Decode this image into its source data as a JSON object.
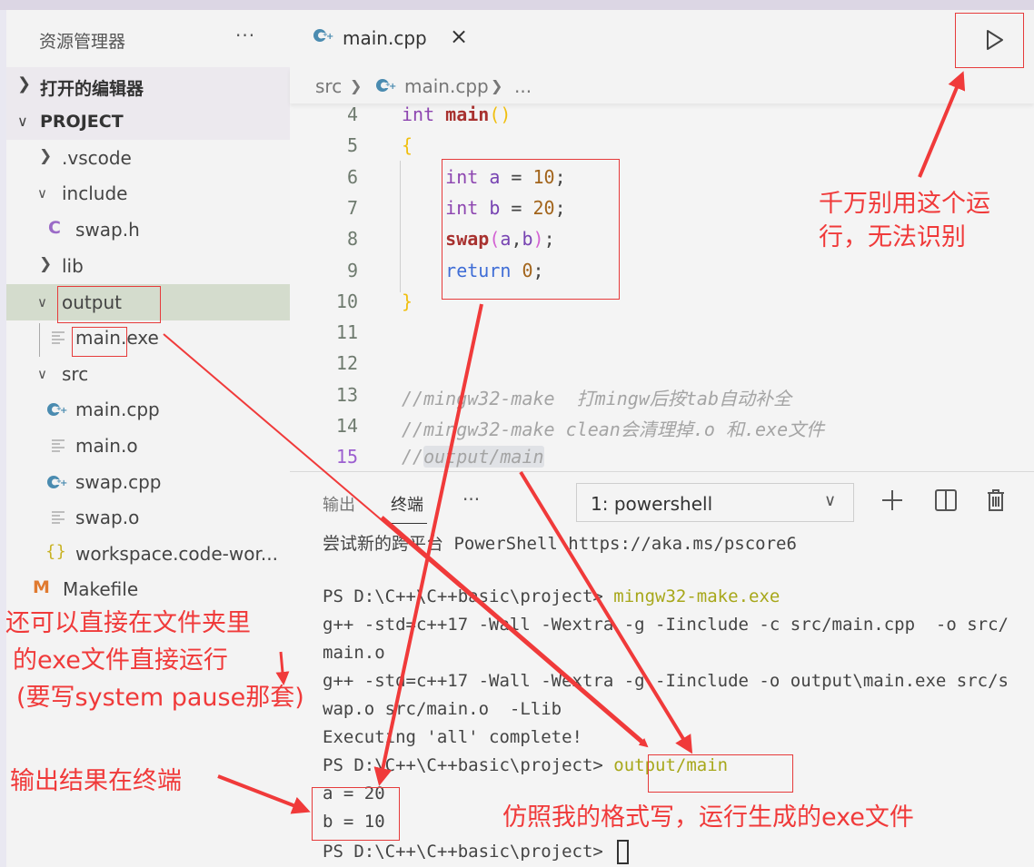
{
  "sidebar": {
    "title": "资源管理器",
    "more_label": "···",
    "open_editors_label": "打开的编辑器",
    "project_label": "PROJECT",
    "tree": [
      {
        "label": ".vscode",
        "type": "folder",
        "expanded": false
      },
      {
        "label": "include",
        "type": "folder",
        "expanded": true
      },
      {
        "label": "swap.h",
        "type": "c-header",
        "icon": "C"
      },
      {
        "label": "lib",
        "type": "folder",
        "expanded": false
      },
      {
        "label": "output",
        "type": "folder",
        "expanded": true,
        "selected": true
      },
      {
        "label": "main.exe",
        "type": "file"
      },
      {
        "label": "src",
        "type": "folder",
        "expanded": true
      },
      {
        "label": "main.cpp",
        "type": "cpp"
      },
      {
        "label": "main.o",
        "type": "file"
      },
      {
        "label": "swap.cpp",
        "type": "cpp"
      },
      {
        "label": "swap.o",
        "type": "file"
      },
      {
        "label": "workspace.code-wor...",
        "type": "json",
        "icon": "{}"
      },
      {
        "label": "Makefile",
        "type": "makefile",
        "icon": "M"
      }
    ]
  },
  "editor": {
    "tab_label": "main.cpp",
    "close_label": "×",
    "breadcrumb": {
      "folder": "src",
      "file": "main.cpp",
      "rest": "..."
    },
    "lines": [
      {
        "n": "4",
        "tokens": [
          [
            "kw",
            "int "
          ],
          [
            "fn",
            "main"
          ],
          [
            "br",
            "()"
          ]
        ]
      },
      {
        "n": "5",
        "tokens": [
          [
            "br",
            "{"
          ]
        ]
      },
      {
        "n": "6",
        "tokens": [
          [
            "pl",
            "    "
          ],
          [
            "kw",
            "int "
          ],
          [
            "var",
            "a"
          ],
          [
            "pl",
            " = "
          ],
          [
            "num",
            "10"
          ],
          [
            "pl",
            ";"
          ]
        ]
      },
      {
        "n": "7",
        "tokens": [
          [
            "pl",
            "    "
          ],
          [
            "kw",
            "int "
          ],
          [
            "var",
            "b"
          ],
          [
            "pl",
            " = "
          ],
          [
            "num",
            "20"
          ],
          [
            "pl",
            ";"
          ]
        ]
      },
      {
        "n": "8",
        "tokens": [
          [
            "pl",
            "    "
          ],
          [
            "fn",
            "swap"
          ],
          [
            "br2",
            "("
          ],
          [
            "var",
            "a"
          ],
          [
            "pl",
            ","
          ],
          [
            "var",
            "b"
          ],
          [
            "br2",
            ")"
          ],
          [
            "pl",
            ";"
          ]
        ]
      },
      {
        "n": "9",
        "tokens": [
          [
            "pl",
            "    "
          ],
          [
            "kw2",
            "return "
          ],
          [
            "num",
            "0"
          ],
          [
            "pl",
            ";"
          ]
        ]
      },
      {
        "n": "10",
        "tokens": [
          [
            "br",
            "}"
          ]
        ]
      },
      {
        "n": "11",
        "tokens": []
      },
      {
        "n": "12",
        "tokens": []
      },
      {
        "n": "13",
        "tokens": [
          [
            "cm",
            "//mingw32-make  打mingw后按tab自动补全"
          ]
        ]
      },
      {
        "n": "14",
        "tokens": [
          [
            "cm",
            "//mingw32-make clean会清理掉.o 和.exe文件"
          ]
        ]
      },
      {
        "n": "15",
        "tokens": [
          [
            "cm",
            "//"
          ],
          [
            "cm cm-hl",
            "output/main"
          ]
        ],
        "active": true
      }
    ]
  },
  "panel": {
    "tabs": [
      "输出",
      "终端"
    ],
    "active_tab": "终端",
    "more_label": "···",
    "terminal_select": "1: powershell",
    "terminal_lines": [
      [
        [
          "pl",
          "尝试新的跨平台 PowerShell https://aka.ms/pscore6"
        ]
      ],
      [],
      [
        [
          "pl",
          "PS D:\\C++\\C++basic\\project> "
        ],
        [
          "tcmd",
          "mingw32-make.exe"
        ]
      ],
      [
        [
          "pl",
          "g++ -std=c++17 -Wall -Wextra -g -Iinclude -c src/main.cpp  -o src/"
        ]
      ],
      [
        [
          "pl",
          "main.o"
        ]
      ],
      [
        [
          "pl",
          "g++ -std=c++17 -Wall -Wextra -g -Iinclude -o output\\main.exe src/s"
        ]
      ],
      [
        [
          "pl",
          "wap.o src/main.o  -Llib"
        ]
      ],
      [
        [
          "pl",
          "Executing 'all' complete!"
        ]
      ],
      [
        [
          "pl",
          "PS D:\\C++\\C++basic\\project> "
        ],
        [
          "tcmd",
          "output/main"
        ]
      ],
      [
        [
          "pl",
          "a = 20"
        ]
      ],
      [
        [
          "pl",
          "b = 10"
        ]
      ],
      [
        [
          "pl",
          "PS D:\\C++\\C++basic\\project> "
        ],
        [
          "cursor",
          ""
        ]
      ]
    ]
  },
  "annotations": {
    "run_warning": [
      "千万别用这个运",
      "行，无法识别"
    ],
    "folder_run": [
      "还可以直接在文件夹里",
      "的exe文件直接运行",
      "(要写system pause那套)"
    ],
    "output_in_terminal": "输出结果在终端",
    "follow_format": "仿照我的格式写，运行生成的exe文件"
  },
  "colors": {
    "annotation_red": "#f03a3a",
    "selected_row": "#d4dccd",
    "cpp_icon": "#4a8bb0",
    "c_icon": "#9b6bc7",
    "makefile_icon": "#e07a30",
    "json_icon": "#c8b222",
    "terminal_command": "#a7a71a"
  }
}
